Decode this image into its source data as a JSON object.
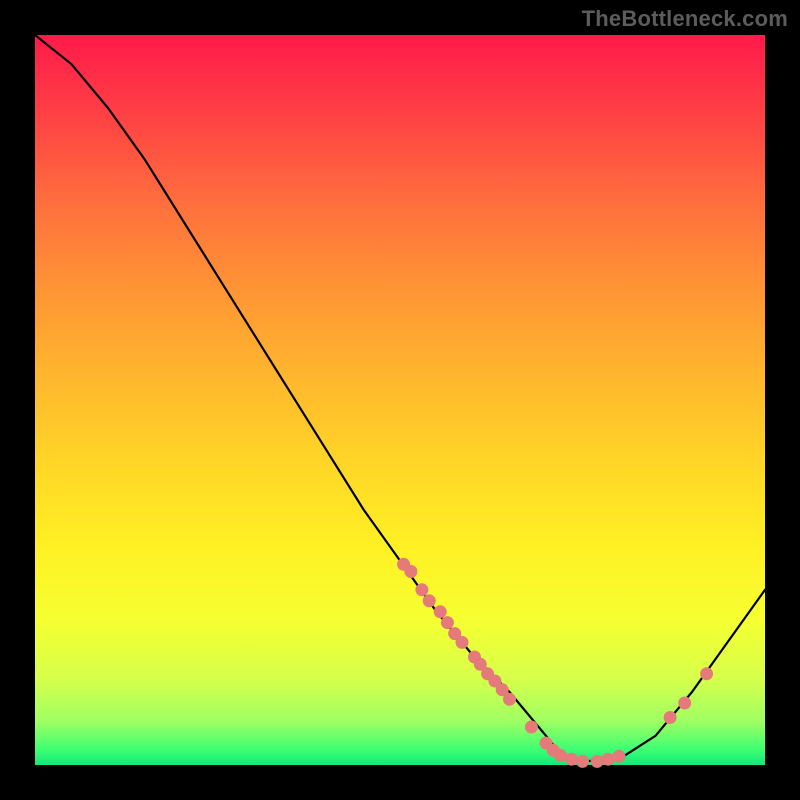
{
  "watermark": "TheBottleneck.com",
  "colors": {
    "background": "#000000",
    "curve_stroke": "#000000",
    "marker_fill": "#e57a7a",
    "gradient_top": "#ff1a4a",
    "gradient_bottom": "#12e87a"
  },
  "chart_data": {
    "type": "line",
    "title": "",
    "xlabel": "",
    "ylabel": "",
    "xlim": [
      0,
      100
    ],
    "ylim": [
      0,
      100
    ],
    "series": [
      {
        "name": "curve",
        "x": [
          0,
          5,
          10,
          15,
          20,
          25,
          30,
          35,
          40,
          45,
          50,
          55,
          60,
          65,
          70,
          72,
          75,
          80,
          85,
          90,
          95,
          100
        ],
        "y": [
          100,
          96,
          90,
          83,
          75,
          67,
          59,
          51,
          43,
          35,
          28,
          21,
          15,
          10,
          4,
          1.5,
          0.5,
          0.8,
          4,
          10,
          17,
          24
        ]
      }
    ],
    "markers": [
      {
        "x": 50.5,
        "y": 27.5
      },
      {
        "x": 51.5,
        "y": 26.5
      },
      {
        "x": 53.0,
        "y": 24.0
      },
      {
        "x": 54.0,
        "y": 22.5
      },
      {
        "x": 55.5,
        "y": 21.0
      },
      {
        "x": 56.5,
        "y": 19.5
      },
      {
        "x": 57.5,
        "y": 18.0
      },
      {
        "x": 58.5,
        "y": 16.8
      },
      {
        "x": 60.2,
        "y": 14.8
      },
      {
        "x": 61.0,
        "y": 13.8
      },
      {
        "x": 62.0,
        "y": 12.5
      },
      {
        "x": 63.0,
        "y": 11.5
      },
      {
        "x": 64.0,
        "y": 10.3
      },
      {
        "x": 65.0,
        "y": 9.0
      },
      {
        "x": 68.0,
        "y": 5.2
      },
      {
        "x": 70.0,
        "y": 3.0
      },
      {
        "x": 71.0,
        "y": 2.0
      },
      {
        "x": 72.0,
        "y": 1.3
      },
      {
        "x": 73.5,
        "y": 0.8
      },
      {
        "x": 75.0,
        "y": 0.5
      },
      {
        "x": 77.0,
        "y": 0.5
      },
      {
        "x": 78.5,
        "y": 0.8
      },
      {
        "x": 80.0,
        "y": 1.2
      },
      {
        "x": 87.0,
        "y": 6.5
      },
      {
        "x": 89.0,
        "y": 8.5
      },
      {
        "x": 92.0,
        "y": 12.5
      }
    ]
  }
}
